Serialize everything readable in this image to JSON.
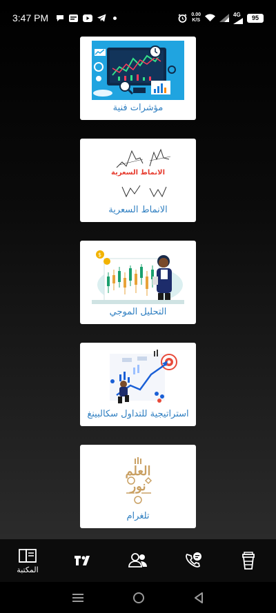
{
  "status_bar": {
    "time": "3:47 PM",
    "net_speed_value": "0.00",
    "net_speed_unit": "K/S",
    "network_type": "4G",
    "battery": "95",
    "left_icons": [
      "chat-icon",
      "news-icon",
      "youtube-icon",
      "telegram-icon",
      "dot-icon"
    ],
    "right_icons": [
      "alarm-icon",
      "wifi-icon",
      "signal-icon",
      "signal-icon"
    ]
  },
  "cards": [
    {
      "label": "مؤشرات فنية",
      "icon": "technical-indicators-image"
    },
    {
      "label": "الانماط السعرية",
      "icon": "price-patterns-image",
      "image_text": "الانماط السعرية"
    },
    {
      "label": "التحليل الموجي",
      "icon": "wave-analysis-image"
    },
    {
      "label": "استراتيجية للتداول سكالبينغ",
      "icon": "scalping-strategy-image"
    },
    {
      "label": "تلغرام",
      "icon": "telegram-logo-image",
      "image_text_top": "العلم",
      "image_text_bottom": "نور"
    }
  ],
  "bottom_nav": {
    "items": [
      {
        "label": "المكتبة",
        "icon": "library-icon"
      },
      {
        "label": "",
        "icon": "tradingview-icon"
      },
      {
        "label": "",
        "icon": "users-icon"
      },
      {
        "label": "",
        "icon": "phone-chat-icon"
      },
      {
        "label": "",
        "icon": "coffee-cup-icon"
      }
    ]
  },
  "colors": {
    "card_label": "#2f7fc1",
    "card_bg": "#ffffff",
    "nav_bg": "#0c0c0c"
  }
}
